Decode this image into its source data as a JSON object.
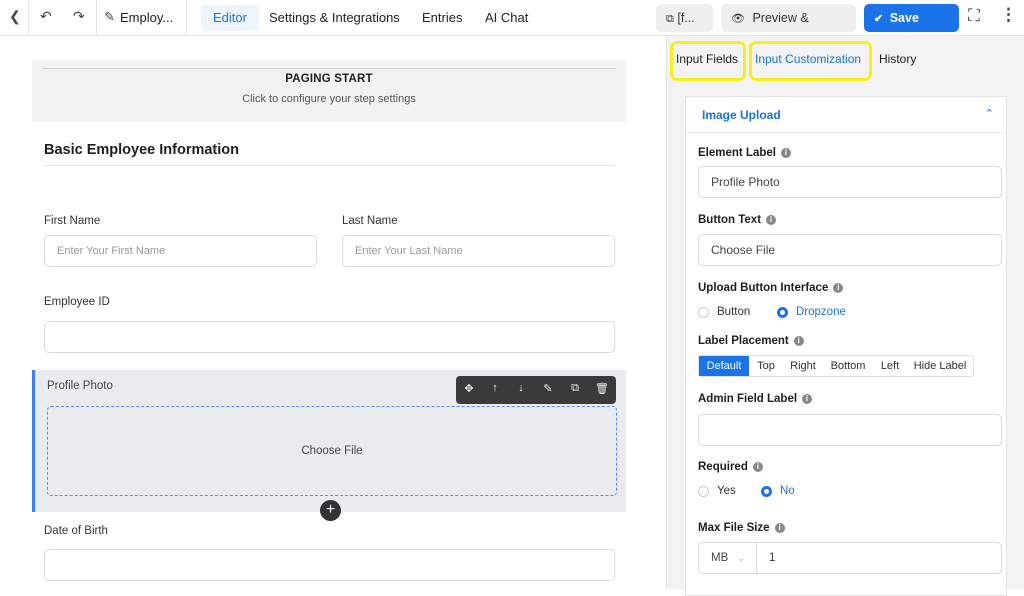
{
  "topbar": {
    "title": "Employ...",
    "tabs": [
      "Editor",
      "Settings & Integrations",
      "Entries",
      "AI Chat"
    ],
    "shortcode_label": "[f...",
    "preview_label": "Preview & Design",
    "save_label": "Save Form",
    "colors": {
      "accent": "#1a73e8"
    }
  },
  "canvas": {
    "paging_title": "PAGING START",
    "paging_sub": "Click to configure your step settings",
    "section_title": "Basic Employee Information",
    "first_name": {
      "label": "First Name",
      "placeholder": "Enter Your First Name"
    },
    "last_name": {
      "label": "Last Name",
      "placeholder": "Enter Your Last Name"
    },
    "employee_id": {
      "label": "Employee ID"
    },
    "profile_photo": {
      "label": "Profile Photo",
      "button_text": "Choose File"
    },
    "dob": {
      "label": "Date of Birth"
    }
  },
  "sidebar": {
    "tabs": [
      "Input Fields",
      "Input Customization",
      "History"
    ],
    "panel_title": "Image Upload",
    "element_label": {
      "label": "Element Label",
      "value": "Profile Photo"
    },
    "button_text": {
      "label": "Button Text",
      "value": "Choose File"
    },
    "upload_interface": {
      "label": "Upload Button Interface",
      "options": [
        "Button",
        "Dropzone"
      ],
      "selected": "Dropzone"
    },
    "label_placement": {
      "label": "Label Placement",
      "options": [
        "Default",
        "Top",
        "Right",
        "Bottom",
        "Left",
        "Hide Label"
      ],
      "selected": "Default"
    },
    "admin_label": {
      "label": "Admin Field Label",
      "value": ""
    },
    "required": {
      "label": "Required",
      "options": [
        "Yes",
        "No"
      ],
      "selected": "No"
    },
    "max_file_size": {
      "label": "Max File Size",
      "unit": "MB",
      "value": "1"
    }
  }
}
